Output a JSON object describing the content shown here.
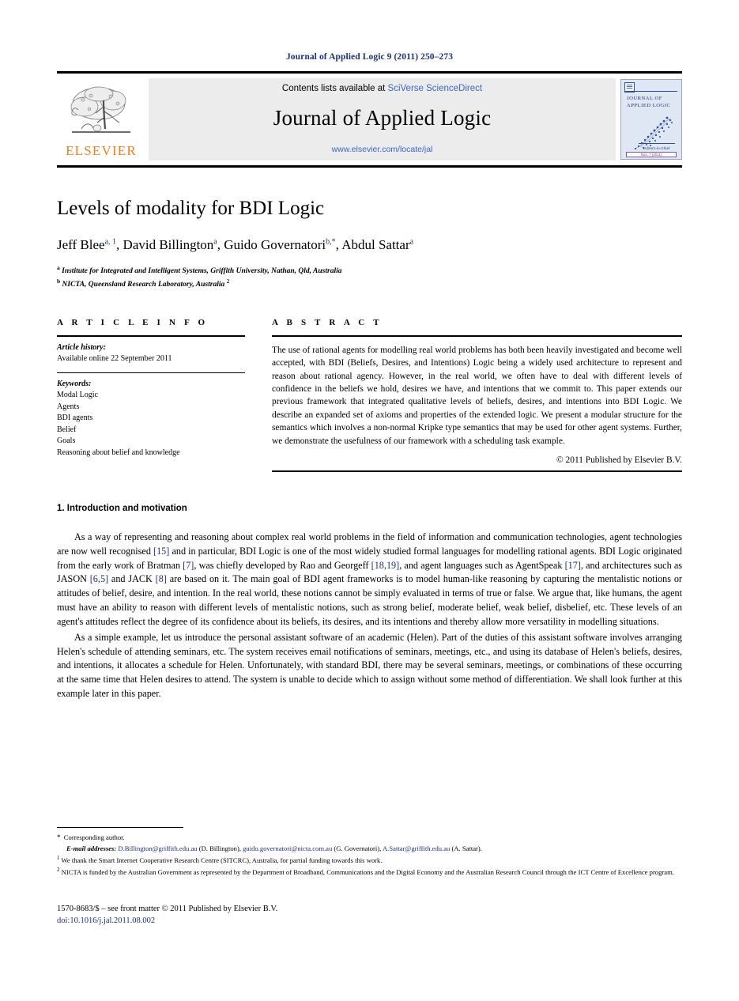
{
  "running_head": "Journal of Applied Logic 9 (2011) 250–273",
  "masthead": {
    "publisher_name": "ELSEVIER",
    "contents_prefix": "Contents lists available at ",
    "sciencedirect_link": "SciVerse ScienceDirect",
    "journal_name": "Journal of Applied Logic",
    "journal_url": "www.elsevier.com/locate/jal",
    "cover": {
      "line1": "JOURNAL OF",
      "line2": "APPLIED LOGIC",
      "editors": "Editors-in-Chief",
      "bottom_bar": "Nos. 7 (2011)"
    }
  },
  "article": {
    "title": "Levels of modality for BDI Logic",
    "authors": [
      {
        "name": "Jeff Blee",
        "marks": "a, 1"
      },
      {
        "name": "David Billington",
        "marks": "a"
      },
      {
        "name": "Guido Governatori",
        "marks": "b,*"
      },
      {
        "name": "Abdul Sattar",
        "marks": "a"
      }
    ],
    "affiliations": [
      {
        "mark": "a",
        "text": "Institute for Integrated and Intelligent Systems, Griffith University, Nathan, Qld, Australia",
        "note": ""
      },
      {
        "mark": "b",
        "text": "NICTA, Queensland Research Laboratory, Australia",
        "note": "2"
      }
    ]
  },
  "article_info": {
    "heading": "A R T I C L E    I N F O",
    "history_label": "Article history:",
    "history_value": "Available online 22 September 2011",
    "keywords_label": "Keywords:",
    "keywords": [
      "Modal Logic",
      "Agents",
      "BDI agents",
      "Belief",
      "Goals",
      "Reasoning about belief and knowledge"
    ]
  },
  "abstract": {
    "heading": "A B S T R A C T",
    "text": "The use of rational agents for modelling real world problems has both been heavily investigated and become well accepted, with BDI (Beliefs, Desires, and Intentions) Logic being a widely used architecture to represent and reason about rational agency. However, in the real world, we often have to deal with different levels of confidence in the beliefs we hold, desires we have, and intentions that we commit to. This paper extends our previous framework that integrated qualitative levels of beliefs, desires, and intentions into BDI Logic. We describe an expanded set of axioms and properties of the extended logic. We present a modular structure for the semantics which involves a non-normal Kripke type semantics that may be used for other agent systems. Further, we demonstrate the usefulness of our framework with a scheduling task example.",
    "copyright": "© 2011 Published by Elsevier B.V."
  },
  "body": {
    "section_number_title": "1. Introduction and motivation",
    "paragraph1_parts": [
      "As a way of representing and reasoning about complex real world problems in the field of information and communication technologies, agent technologies are now well recognised ",
      "[15]",
      " and in particular, BDI Logic is one of the most widely studied formal languages for modelling rational agents. BDI Logic originated from the early work of Bratman ",
      "[7]",
      ", was chiefly developed by Rao and Georgeff ",
      "[18,19]",
      ", and agent languages such as AgentSpeak ",
      "[17]",
      ", and architectures such as JASON ",
      "[6,5]",
      " and JACK ",
      "[8]",
      " are based on it. The main goal of BDI agent frameworks is to model human-like reasoning by capturing the mentalistic notions or attitudes of belief, desire, and intention. In the real world, these notions cannot be simply evaluated in terms of true or false. We argue that, like humans, the agent must have an ability to reason with different levels of mentalistic notions, such as strong belief, moderate belief, weak belief, disbelief, etc. These levels of an agent's attitudes reflect the degree of its confidence about its beliefs, its desires, and its intentions and thereby allow more versatility in modelling situations."
    ],
    "paragraph2": "As a simple example, let us introduce the personal assistant software of an academic (Helen). Part of the duties of this assistant software involves arranging Helen's schedule of attending seminars, etc. The system receives email notifications of seminars, meetings, etc., and using its database of Helen's beliefs, desires, and intentions, it allocates a schedule for Helen. Unfortunately, with standard BDI, there may be several seminars, meetings, or combinations of these occurring at the same time that Helen desires to attend. The system is unable to decide which to assign without some method of differentiation. We shall look further at this example later in this paper."
  },
  "footnotes": {
    "corresponding": "Corresponding author.",
    "email_label": "E-mail addresses:",
    "emails": [
      {
        "address": "D.Billington@griffith.edu.au",
        "owner": "(D. Billington)"
      },
      {
        "address": "guido.governatori@nicta.com.au",
        "owner": "(G. Governatori)"
      },
      {
        "address": "A.Sattar@griffith.edu.au",
        "owner": "(A. Sattar)"
      }
    ],
    "note1_mark": "1",
    "note1": "We thank the Smart Internet Cooperative Research Centre (SITCRC), Australia, for partial funding towards this work.",
    "note2_mark": "2",
    "note2": "NICTA is funded by the Australian Government as represented by the Department of Broadband, Communications and the Digital Economy and the Australian Research Council through the ICT Centre of Excellence program."
  },
  "footer": {
    "issn_line": "1570-8683/$ – see front matter © 2011 Published by Elsevier B.V.",
    "doi": "doi:10.1016/j.jal.2011.08.002"
  },
  "colors": {
    "link_blue": "#3a66c4",
    "dark_blue": "#1f3079",
    "elsevier_orange": "#ef7f1a",
    "banner_gray": "#ececec"
  }
}
